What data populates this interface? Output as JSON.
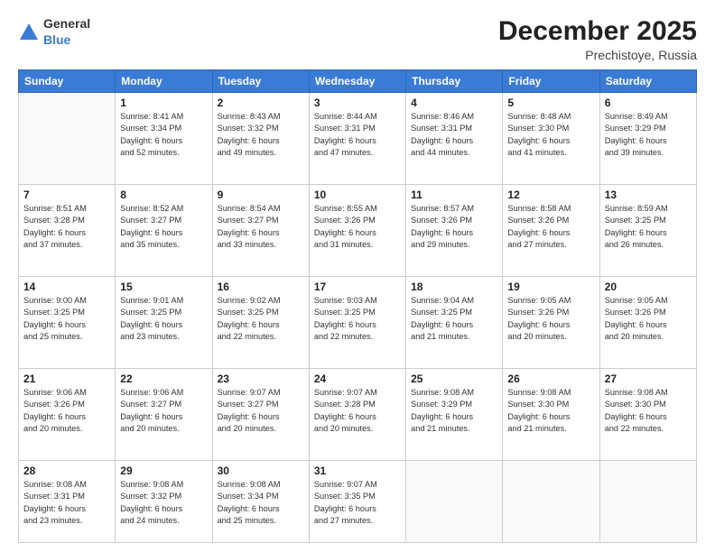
{
  "header": {
    "logo_general": "General",
    "logo_blue": "Blue",
    "month": "December 2025",
    "location": "Prechistoye, Russia"
  },
  "days_of_week": [
    "Sunday",
    "Monday",
    "Tuesday",
    "Wednesday",
    "Thursday",
    "Friday",
    "Saturday"
  ],
  "weeks": [
    [
      {
        "day": null,
        "sunrise": null,
        "sunset": null,
        "daylight": null
      },
      {
        "day": "1",
        "sunrise": "8:41 AM",
        "sunset": "3:34 PM",
        "daylight": "6 hours and 52 minutes."
      },
      {
        "day": "2",
        "sunrise": "8:43 AM",
        "sunset": "3:32 PM",
        "daylight": "6 hours and 49 minutes."
      },
      {
        "day": "3",
        "sunrise": "8:44 AM",
        "sunset": "3:31 PM",
        "daylight": "6 hours and 47 minutes."
      },
      {
        "day": "4",
        "sunrise": "8:46 AM",
        "sunset": "3:31 PM",
        "daylight": "6 hours and 44 minutes."
      },
      {
        "day": "5",
        "sunrise": "8:48 AM",
        "sunset": "3:30 PM",
        "daylight": "6 hours and 41 minutes."
      },
      {
        "day": "6",
        "sunrise": "8:49 AM",
        "sunset": "3:29 PM",
        "daylight": "6 hours and 39 minutes."
      }
    ],
    [
      {
        "day": "7",
        "sunrise": "8:51 AM",
        "sunset": "3:28 PM",
        "daylight": "6 hours and 37 minutes."
      },
      {
        "day": "8",
        "sunrise": "8:52 AM",
        "sunset": "3:27 PM",
        "daylight": "6 hours and 35 minutes."
      },
      {
        "day": "9",
        "sunrise": "8:54 AM",
        "sunset": "3:27 PM",
        "daylight": "6 hours and 33 minutes."
      },
      {
        "day": "10",
        "sunrise": "8:55 AM",
        "sunset": "3:26 PM",
        "daylight": "6 hours and 31 minutes."
      },
      {
        "day": "11",
        "sunrise": "8:57 AM",
        "sunset": "3:26 PM",
        "daylight": "6 hours and 29 minutes."
      },
      {
        "day": "12",
        "sunrise": "8:58 AM",
        "sunset": "3:26 PM",
        "daylight": "6 hours and 27 minutes."
      },
      {
        "day": "13",
        "sunrise": "8:59 AM",
        "sunset": "3:25 PM",
        "daylight": "6 hours and 26 minutes."
      }
    ],
    [
      {
        "day": "14",
        "sunrise": "9:00 AM",
        "sunset": "3:25 PM",
        "daylight": "6 hours and 25 minutes."
      },
      {
        "day": "15",
        "sunrise": "9:01 AM",
        "sunset": "3:25 PM",
        "daylight": "6 hours and 23 minutes."
      },
      {
        "day": "16",
        "sunrise": "9:02 AM",
        "sunset": "3:25 PM",
        "daylight": "6 hours and 22 minutes."
      },
      {
        "day": "17",
        "sunrise": "9:03 AM",
        "sunset": "3:25 PM",
        "daylight": "6 hours and 22 minutes."
      },
      {
        "day": "18",
        "sunrise": "9:04 AM",
        "sunset": "3:25 PM",
        "daylight": "6 hours and 21 minutes."
      },
      {
        "day": "19",
        "sunrise": "9:05 AM",
        "sunset": "3:26 PM",
        "daylight": "6 hours and 20 minutes."
      },
      {
        "day": "20",
        "sunrise": "9:05 AM",
        "sunset": "3:26 PM",
        "daylight": "6 hours and 20 minutes."
      }
    ],
    [
      {
        "day": "21",
        "sunrise": "9:06 AM",
        "sunset": "3:26 PM",
        "daylight": "6 hours and 20 minutes."
      },
      {
        "day": "22",
        "sunrise": "9:06 AM",
        "sunset": "3:27 PM",
        "daylight": "6 hours and 20 minutes."
      },
      {
        "day": "23",
        "sunrise": "9:07 AM",
        "sunset": "3:27 PM",
        "daylight": "6 hours and 20 minutes."
      },
      {
        "day": "24",
        "sunrise": "9:07 AM",
        "sunset": "3:28 PM",
        "daylight": "6 hours and 20 minutes."
      },
      {
        "day": "25",
        "sunrise": "9:08 AM",
        "sunset": "3:29 PM",
        "daylight": "6 hours and 21 minutes."
      },
      {
        "day": "26",
        "sunrise": "9:08 AM",
        "sunset": "3:30 PM",
        "daylight": "6 hours and 21 minutes."
      },
      {
        "day": "27",
        "sunrise": "9:08 AM",
        "sunset": "3:30 PM",
        "daylight": "6 hours and 22 minutes."
      }
    ],
    [
      {
        "day": "28",
        "sunrise": "9:08 AM",
        "sunset": "3:31 PM",
        "daylight": "6 hours and 23 minutes."
      },
      {
        "day": "29",
        "sunrise": "9:08 AM",
        "sunset": "3:32 PM",
        "daylight": "6 hours and 24 minutes."
      },
      {
        "day": "30",
        "sunrise": "9:08 AM",
        "sunset": "3:34 PM",
        "daylight": "6 hours and 25 minutes."
      },
      {
        "day": "31",
        "sunrise": "9:07 AM",
        "sunset": "3:35 PM",
        "daylight": "6 hours and 27 minutes."
      },
      null,
      null,
      null
    ]
  ]
}
